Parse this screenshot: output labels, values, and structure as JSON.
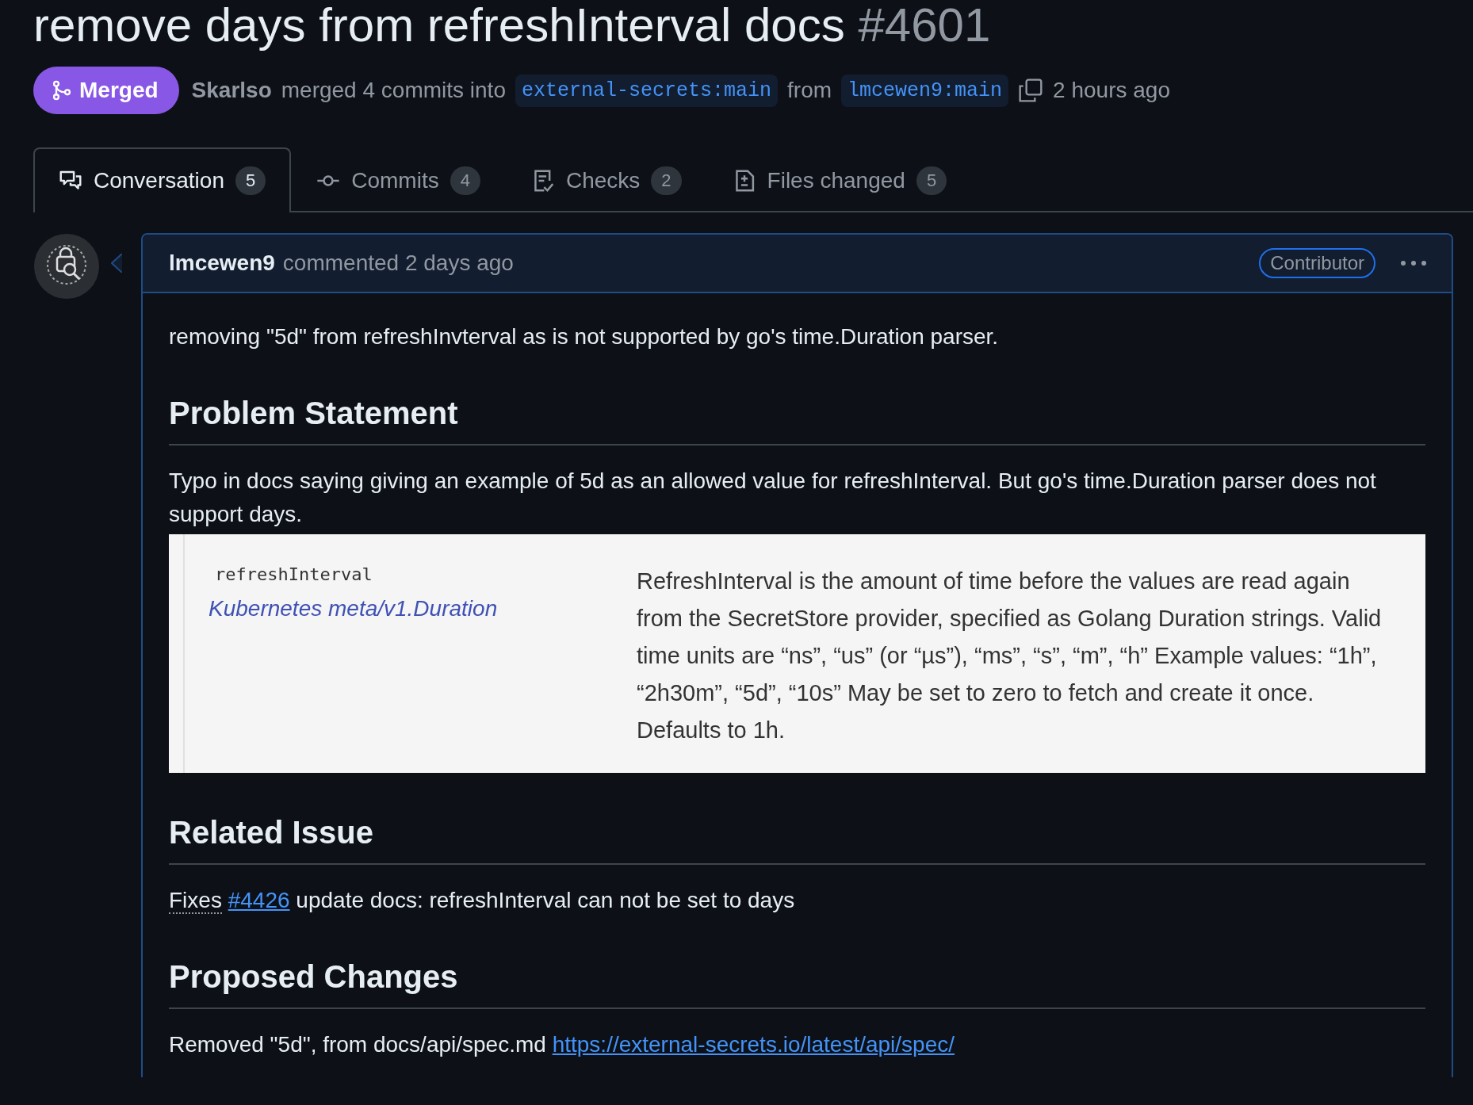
{
  "title": "remove days from refreshInterval docs",
  "number": "#4601",
  "state": {
    "label": "Merged",
    "kind": "merged"
  },
  "merge_info": {
    "author": "Skarlso",
    "text": "merged 4 commits into",
    "base": "external-secrets:main",
    "from": "from",
    "head": "lmcewen9:main",
    "time": "2 hours ago"
  },
  "tabs": [
    {
      "label": "Conversation",
      "count": "5",
      "selected": true
    },
    {
      "label": "Commits",
      "count": "4",
      "selected": false
    },
    {
      "label": "Checks",
      "count": "2",
      "selected": false
    },
    {
      "label": "Files changed",
      "count": "5",
      "selected": false
    }
  ],
  "comment": {
    "author": "lmcewen9",
    "action": "commented 2 days ago",
    "badge": "Contributor",
    "body": [
      {
        "kind": "paragraph",
        "text": "removing \"5d\" from refreshInvterval as is not supported by go's time.Duration parser."
      },
      {
        "kind": "heading",
        "text": "Problem Statement"
      },
      {
        "kind": "paragraph",
        "text": "Typo in docs saying giving an example of 5d as an allowed value for refreshInterval. But go's time.Duration parser does not support days."
      },
      {
        "kind": "screenshot",
        "field": "refreshInterval",
        "type": "Kubernetes meta/v1.Duration",
        "description": "RefreshInterval is the amount of time before the values are read again from the SecretStore provider, specified as Golang Duration strings. Valid time units are “ns”, “us” (or “µs”), “ms”, “s”, “m”, “h” Example values: “1h”, “2h30m”, “5d”, “10s” May be set to zero to fetch and create it once. Defaults to 1h."
      },
      {
        "kind": "heading",
        "text": "Related Issue"
      },
      {
        "kind": "issue",
        "prefix": "Fixes",
        "link": "#4426",
        "text": "update docs: refreshInterval can not be set to days"
      },
      {
        "kind": "heading",
        "text": "Proposed Changes"
      },
      {
        "kind": "link_paragraph",
        "text": "Removed \"5d\", from docs/api/spec.md",
        "link": "https://external-secrets.io/latest/api/spec/"
      }
    ]
  }
}
